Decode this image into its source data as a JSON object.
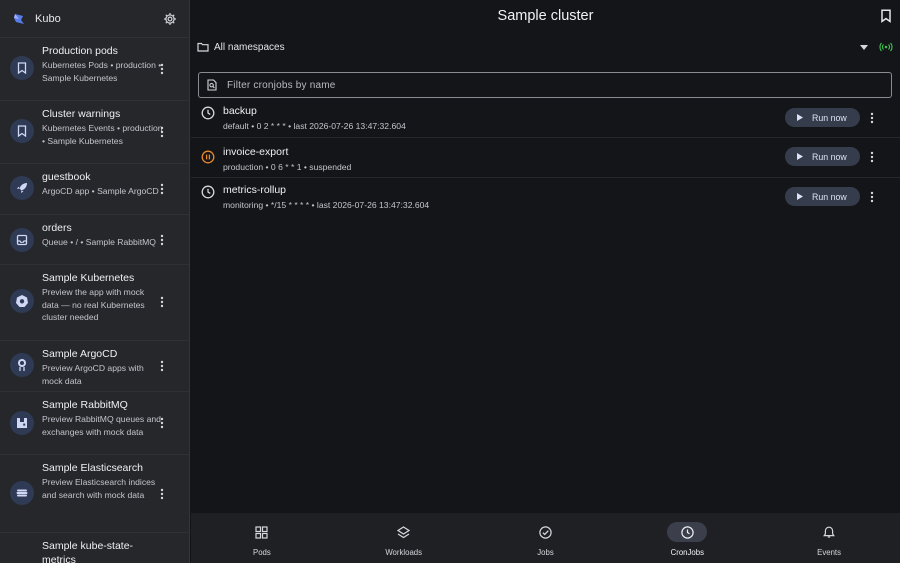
{
  "app": {
    "name": "Kubo"
  },
  "sidebar": {
    "items": [
      {
        "name": "Production pods",
        "subtitle": "Kubernetes Pods • production • Sample Kubernetes",
        "icon": "bookmark-icon"
      },
      {
        "name": "Cluster warnings",
        "subtitle": "Kubernetes Events • production • Sample Kubernetes",
        "icon": "bookmark-icon"
      },
      {
        "name": "guestbook",
        "subtitle": "ArgoCD app • Sample ArgoCD",
        "icon": "rocket-icon"
      },
      {
        "name": "orders",
        "subtitle": "Queue • / • Sample RabbitMQ",
        "icon": "inbox-icon"
      },
      {
        "name": "Sample Kubernetes",
        "subtitle": "Preview the app with mock data — no real Kubernetes cluster needed",
        "icon": "kubernetes-icon"
      },
      {
        "name": "Sample ArgoCD",
        "subtitle": "Preview ArgoCD apps with mock data",
        "icon": "argocd-icon"
      },
      {
        "name": "Sample RabbitMQ",
        "subtitle": "Preview RabbitMQ queues and exchanges with mock data",
        "icon": "rabbitmq-icon"
      },
      {
        "name": "Sample Elasticsearch",
        "subtitle": "Preview Elasticsearch indices and search with mock data",
        "icon": "elasticsearch-icon"
      },
      {
        "name": "Sample kube-state-metrics",
        "subtitle": "",
        "icon": "kube-state-metrics-icon"
      }
    ]
  },
  "header": {
    "title": "Sample cluster"
  },
  "namespace": {
    "label": "All namespaces"
  },
  "filter": {
    "placeholder": "Filter cronjobs by name",
    "value": ""
  },
  "cronjobs": [
    {
      "name": "backup",
      "detail": "default • 0 2 * * * • last 2026-07-26 13:47:32.604",
      "status": "scheduled",
      "icon": "clock-icon",
      "run_label": "Run now"
    },
    {
      "name": "invoice-export",
      "detail": "production • 0 6 * * 1 • suspended",
      "status": "suspended",
      "icon": "pause-circle-icon",
      "run_label": "Run now"
    },
    {
      "name": "metrics-rollup",
      "detail": "monitoring • */15 * * * * • last 2026-07-26 13:47:32.604",
      "status": "scheduled",
      "icon": "clock-icon",
      "run_label": "Run now"
    }
  ],
  "bottom_nav": [
    {
      "label": "Pods",
      "icon": "pods-grid-icon",
      "active": false
    },
    {
      "label": "Workloads",
      "icon": "layers-icon",
      "active": false
    },
    {
      "label": "Jobs",
      "icon": "check-circle-icon",
      "active": false
    },
    {
      "label": "CronJobs",
      "icon": "clock-icon",
      "active": true
    },
    {
      "label": "Events",
      "icon": "bell-icon",
      "active": false
    }
  ],
  "colors": {
    "background": "#141518",
    "sidebar": "#26272b",
    "accent_pill": "#353c4c",
    "live_green": "#3fbf4f",
    "suspended_orange": "#e8892b"
  }
}
